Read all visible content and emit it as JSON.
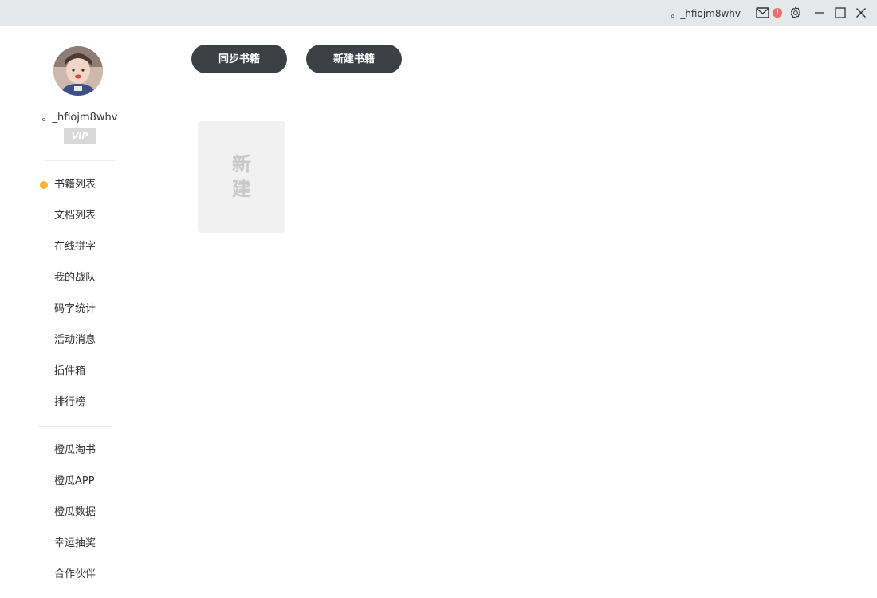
{
  "titlebar": {
    "username": "。_hfiojm8whv",
    "alert_badge": "!",
    "icons": [
      "mail-icon",
      "alert-icon",
      "gear-icon",
      "minimize-icon",
      "maximize-icon",
      "close-icon"
    ]
  },
  "sidebar": {
    "username": "。_hfiojm8whv",
    "vip_label": "VIP",
    "accent_color": "#f6b530",
    "nav_primary": [
      {
        "label": "书籍列表",
        "active": true
      },
      {
        "label": "文档列表"
      },
      {
        "label": "在线拼字"
      },
      {
        "label": "我的战队"
      },
      {
        "label": "码字统计"
      },
      {
        "label": "活动消息"
      },
      {
        "label": "插件箱"
      },
      {
        "label": "排行榜"
      }
    ],
    "nav_secondary": [
      {
        "label": "橙瓜淘书"
      },
      {
        "label": "橙瓜APP"
      },
      {
        "label": "橙瓜数据"
      },
      {
        "label": "幸运抽奖"
      },
      {
        "label": "合作伙伴"
      }
    ]
  },
  "main": {
    "sync_button": "同步书籍",
    "new_button": "新建书籍",
    "new_book_card": "新建"
  },
  "colors": {
    "button_bg": "#3c4045",
    "titlebar_bg": "#e6e7e9",
    "alert": "#ef6b6b"
  }
}
